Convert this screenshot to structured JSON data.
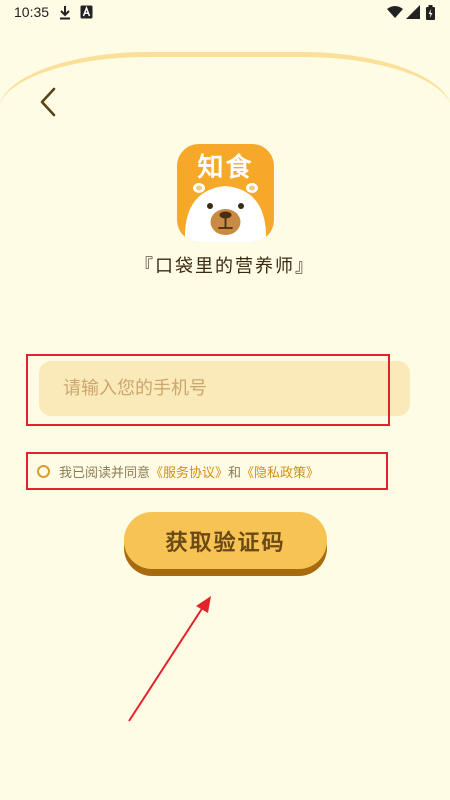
{
  "status_bar": {
    "time": "10:35",
    "icons": [
      "download-icon",
      "a-notification-icon",
      "wifi-icon",
      "signal-icon",
      "battery-icon"
    ]
  },
  "header": {
    "back_icon": "chevron-left-icon"
  },
  "logo": {
    "text": "知食",
    "icon": "capybara-mascot",
    "background_color": "#F6A928"
  },
  "slogan": "『口袋里的营养师』",
  "phone_input": {
    "value": "",
    "placeholder": "请输入您的手机号"
  },
  "agreement": {
    "checked": false,
    "text": "我已阅读并同意",
    "link1": "《服务协议》",
    "joiner": "和",
    "link2": "《隐私政策》"
  },
  "get_code_button": {
    "label": "获取验证码"
  },
  "colors": {
    "background": "#FFFCE6",
    "accent": "#F7C355",
    "link": "#D28E16",
    "annotation": "#E3232B"
  }
}
